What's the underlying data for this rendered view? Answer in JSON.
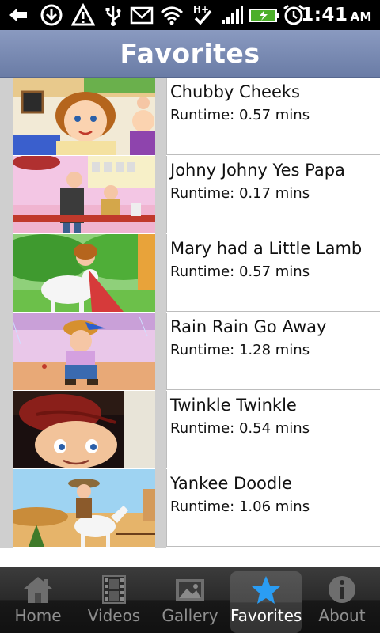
{
  "status_bar": {
    "time": "1:41",
    "ampm": "AM",
    "network": "H+",
    "icons": [
      "back-arrow-icon",
      "download-icon",
      "warning-icon",
      "usb-icon",
      "gmail-icon",
      "wifi-icon",
      "network-h-plus-icon",
      "signal-icon",
      "battery-charging-icon",
      "alarm-icon"
    ]
  },
  "header": {
    "title": "Favorites"
  },
  "favorites": [
    {
      "title": "Chubby Cheeks",
      "runtime": "Runtime: 0.57 mins"
    },
    {
      "title": "Johny Johny Yes Papa",
      "runtime": "Runtime: 0.17 mins"
    },
    {
      "title": "Mary had a Little Lamb",
      "runtime": "Runtime: 0.57 mins"
    },
    {
      "title": "Rain Rain Go Away",
      "runtime": "Runtime: 1.28 mins"
    },
    {
      "title": "Twinkle Twinkle",
      "runtime": "Runtime: 0.54 mins"
    },
    {
      "title": "Yankee Doodle",
      "runtime": "Runtime: 1.06 mins"
    }
  ],
  "tabs": [
    {
      "label": "Home",
      "icon": "home-icon",
      "active": false
    },
    {
      "label": "Videos",
      "icon": "film-icon",
      "active": false
    },
    {
      "label": "Gallery",
      "icon": "gallery-icon",
      "active": false
    },
    {
      "label": "Favorites",
      "icon": "star-icon",
      "active": true
    },
    {
      "label": "About",
      "icon": "info-icon",
      "active": false
    }
  ],
  "colors": {
    "title_bar": "#7a8bb4",
    "active_star": "#2a9df4"
  }
}
